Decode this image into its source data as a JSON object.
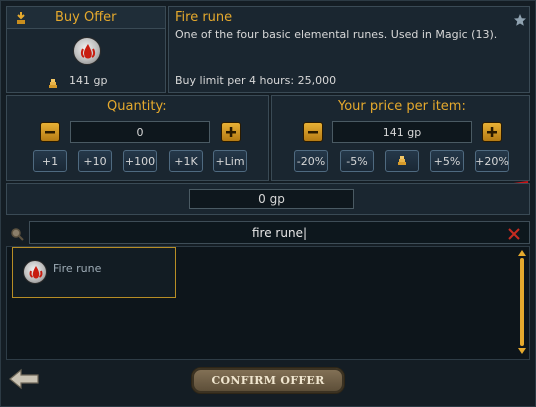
{
  "offer": {
    "header_label": "Buy Offer",
    "item_name": "Fire rune",
    "item_description": "One of the four basic elemental runes. Used in Magic (13).",
    "price_display": "141 gp",
    "buy_limit": "Buy limit per 4 hours: 25,000"
  },
  "quantity": {
    "label": "Quantity:",
    "value": "0",
    "buttons": [
      "+1",
      "+10",
      "+100",
      "+1K",
      "+Lim"
    ]
  },
  "price": {
    "label": "Your price per item:",
    "value": "141 gp",
    "buttons": [
      "-20%",
      "-5%",
      "+5%",
      "+20%"
    ]
  },
  "total": {
    "value": "0 gp"
  },
  "search": {
    "value": "fire rune|"
  },
  "results": [
    {
      "name": "Fire rune"
    }
  ],
  "footer": {
    "confirm_label": "CONFIRM OFFER"
  },
  "icons": {
    "header": "coin-bag-icon",
    "favourite": "star-icon",
    "search": "magnifier-icon",
    "clear": "close-icon",
    "back": "back-arrow-icon"
  },
  "colors": {
    "accent_gold": "#e5a92d",
    "panel_bg": "#1a2630",
    "dark_bg": "#0b1117"
  }
}
